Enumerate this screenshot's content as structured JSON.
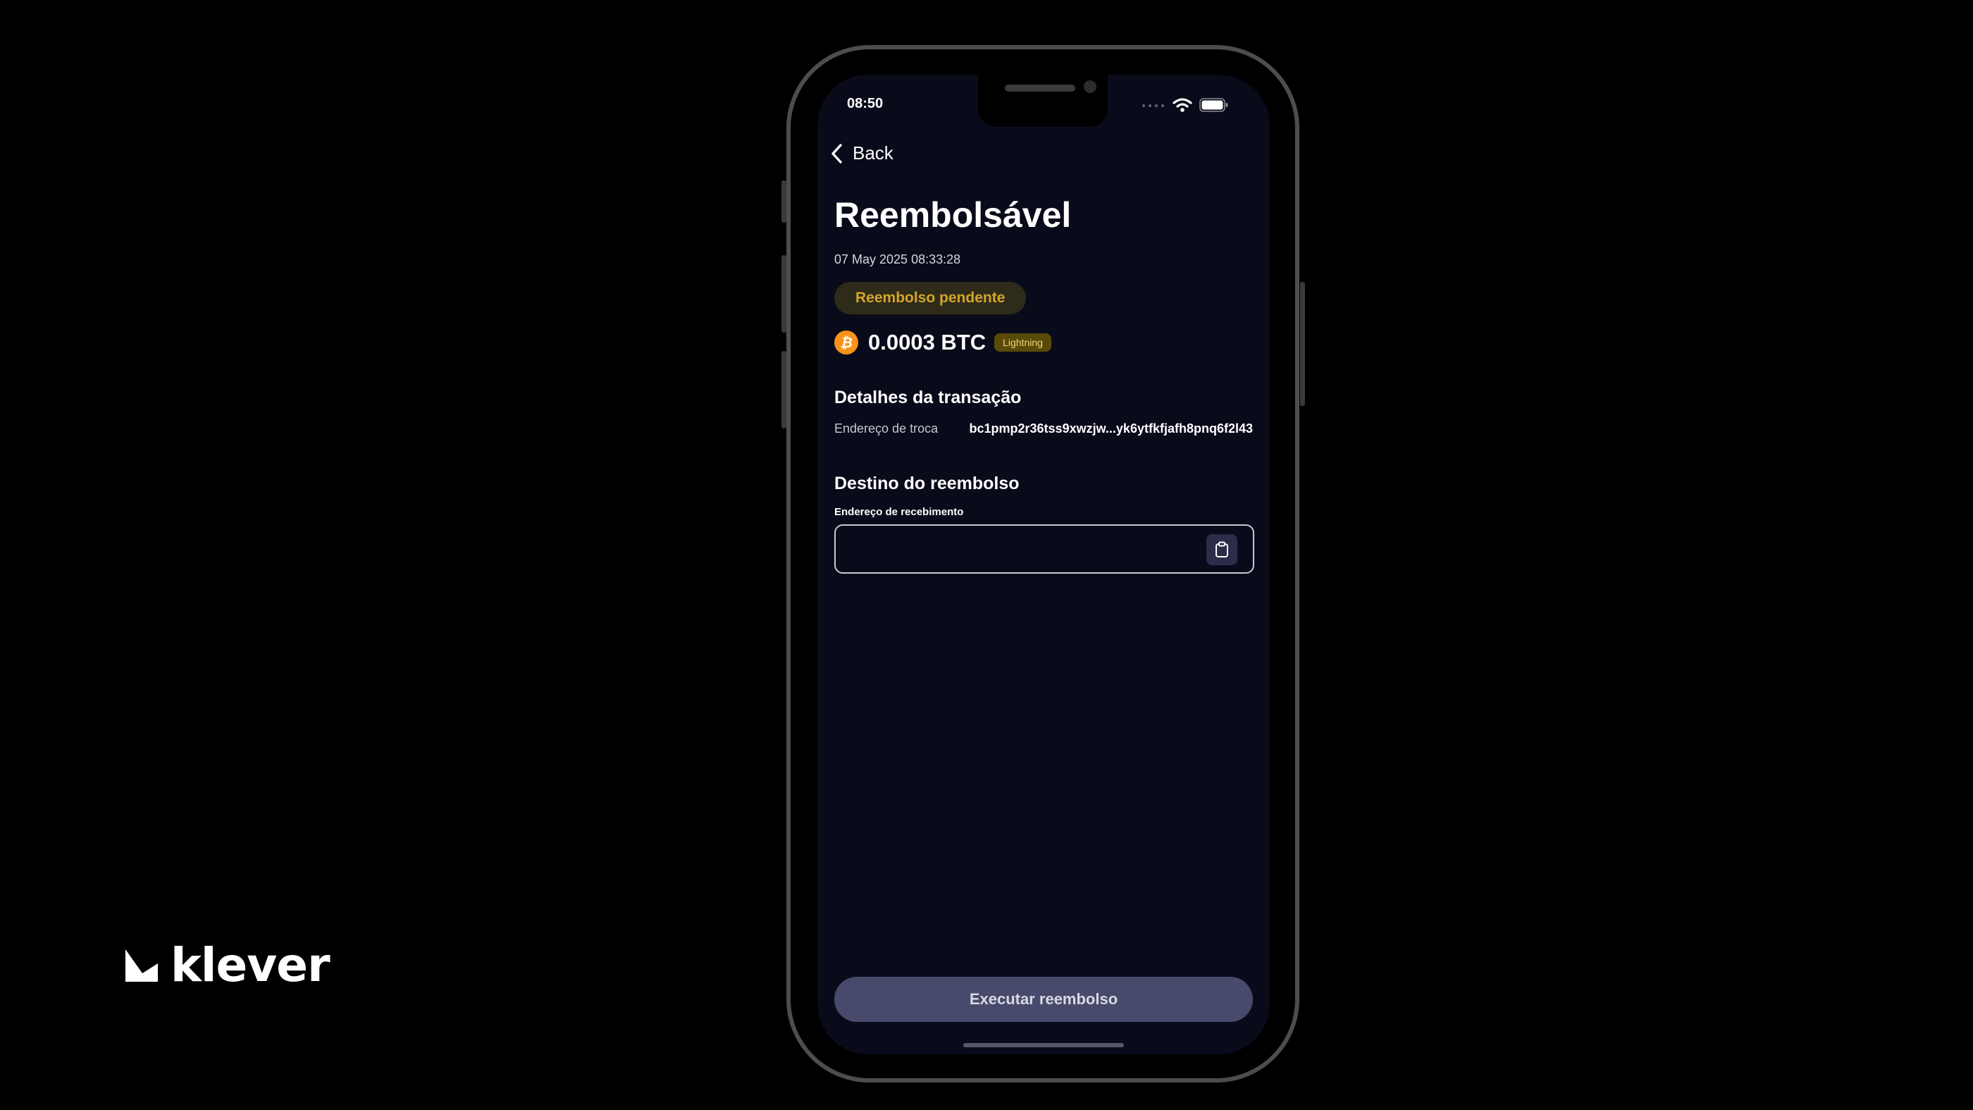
{
  "brand": {
    "name": "klever"
  },
  "status_bar": {
    "time": "08:50"
  },
  "nav": {
    "back_label": "Back"
  },
  "header": {
    "title": "Reembolsável",
    "date": "07 May 2025 08:33:28",
    "status_badge": "Reembolso pendente"
  },
  "amount": {
    "value": "0.0003 BTC",
    "network_badge": "Lightning",
    "coin_icon": "bitcoin-icon"
  },
  "transaction_details": {
    "title": "Detalhes da transação",
    "rows": [
      {
        "label": "Endereço de troca",
        "value": "bc1pmp2r36tss9xwzjw...yk6ytfkfjafh8pnq6f2l43"
      }
    ]
  },
  "refund_destination": {
    "title": "Destino do reembolso",
    "field_label": "Endereço de recebimento",
    "field_value": "",
    "field_placeholder": "",
    "paste_icon": "clipboard-icon"
  },
  "actions": {
    "primary_label": "Executar reembolso"
  },
  "colors": {
    "page_background": "#000000",
    "screen_background": "#0a0b1a",
    "pending_badge_bg": "#2f2b1a",
    "pending_badge_text": "#d4a52b",
    "network_badge_bg": "#5a4a08",
    "bitcoin_orange": "#f7931a",
    "button_bg": "#474a6b"
  }
}
